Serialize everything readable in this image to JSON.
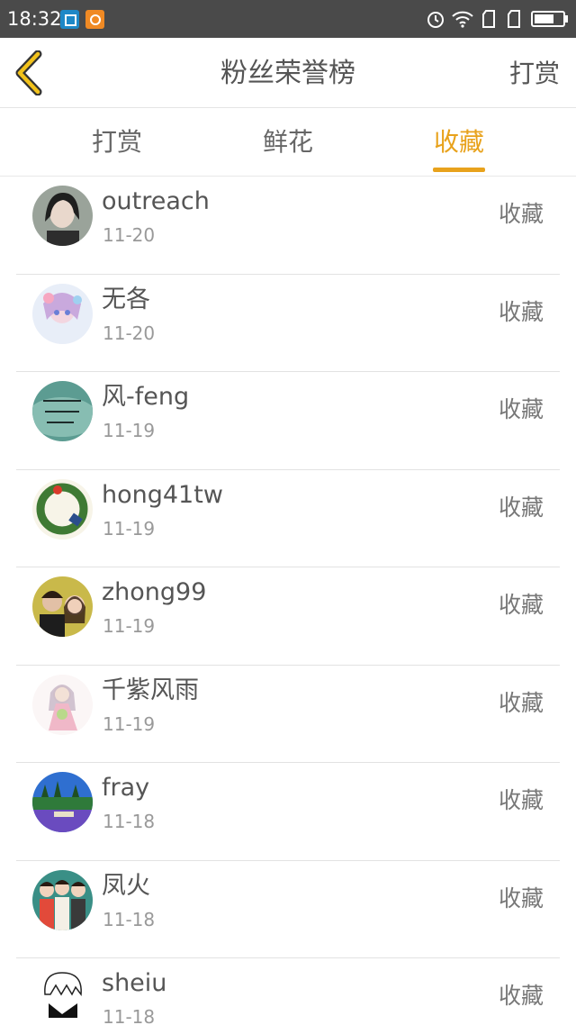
{
  "status_bar": {
    "time": "18:32"
  },
  "header": {
    "title": "粉丝荣誉榜",
    "right_action": "打赏"
  },
  "tabs": [
    {
      "label": "打赏"
    },
    {
      "label": "鲜花"
    },
    {
      "label": "收藏"
    }
  ],
  "active_tab": "收藏",
  "colors": {
    "accent": "#e8a21c",
    "status_bar": "#4a4a4a"
  },
  "fans": [
    {
      "name": "outreach",
      "date": "11-20",
      "action": "收藏"
    },
    {
      "name": "无各",
      "date": "11-20",
      "action": "收藏"
    },
    {
      "name": "风-feng",
      "date": "11-19",
      "action": "收藏"
    },
    {
      "name": "hong41tw",
      "date": "11-19",
      "action": "收藏"
    },
    {
      "name": "zhong99",
      "date": "11-19",
      "action": "收藏"
    },
    {
      "name": "千紫风雨",
      "date": "11-19",
      "action": "收藏"
    },
    {
      "name": "fray",
      "date": "11-18",
      "action": "收藏"
    },
    {
      "name": "凤火",
      "date": "11-18",
      "action": "收藏"
    },
    {
      "name": "sheiu",
      "date": "11-18",
      "action": "收藏"
    }
  ]
}
